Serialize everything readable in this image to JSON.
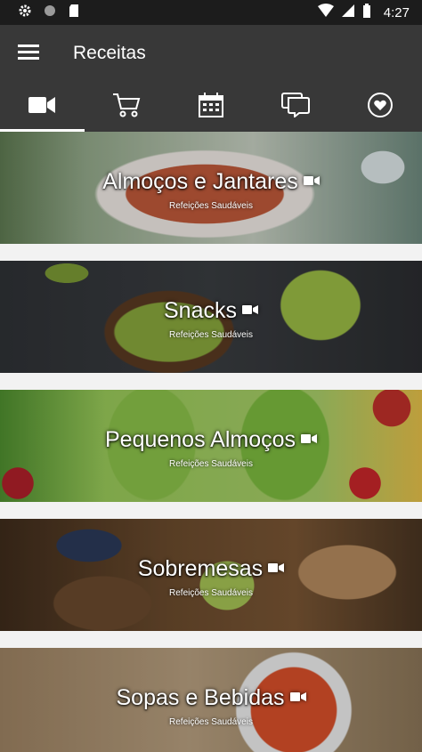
{
  "status_bar": {
    "time": "4:27",
    "left_icons": [
      "settings-icon",
      "circle-icon",
      "sd-card-icon"
    ],
    "right_icons": [
      "wifi-icon",
      "signal-icon",
      "battery-icon"
    ]
  },
  "app_bar": {
    "title": "Receitas",
    "menu_icon": "hamburger-menu-icon"
  },
  "tabs": [
    {
      "icon": "video-camera-icon",
      "active": true
    },
    {
      "icon": "shopping-cart-icon",
      "active": false
    },
    {
      "icon": "calendar-icon",
      "active": false
    },
    {
      "icon": "chat-icon",
      "active": false
    },
    {
      "icon": "heart-icon",
      "active": false
    }
  ],
  "categories": [
    {
      "title": "Almoços e Jantares",
      "subtitle": "Refeições Saudáveis"
    },
    {
      "title": "Snacks",
      "subtitle": "Refeições Saudáveis"
    },
    {
      "title": "Pequenos Almoços",
      "subtitle": "Refeições Saudáveis"
    },
    {
      "title": "Sobremesas",
      "subtitle": "Refeições Saudáveis"
    },
    {
      "title": "Sopas e Bebidas",
      "subtitle": "Refeições Saudáveis"
    }
  ],
  "colors": {
    "status_bar": "#1c1c1c",
    "app_bar": "#383838",
    "tab_indicator": "#ffffff",
    "background": "#f2f2f2"
  }
}
